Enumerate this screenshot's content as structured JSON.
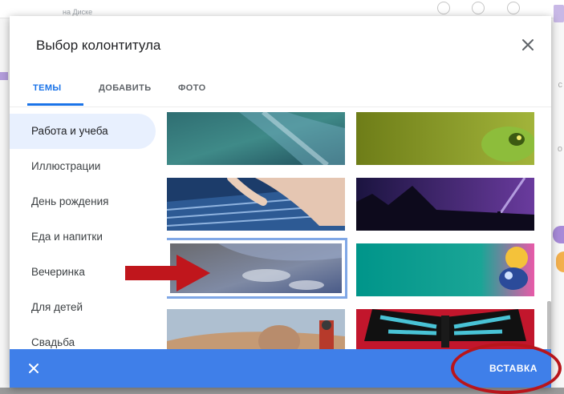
{
  "background": {
    "breadcrumb": "на Диске"
  },
  "dialog": {
    "title": "Выбор колонтитула",
    "tabs": [
      {
        "label": "ТЕМЫ",
        "active": true
      },
      {
        "label": "ДОБАВИТЬ",
        "active": false
      },
      {
        "label": "ФОТО",
        "active": false
      }
    ],
    "categories": [
      {
        "label": "Работа и учеба",
        "active": true
      },
      {
        "label": "Иллюстрации",
        "active": false
      },
      {
        "label": "День рождения",
        "active": false
      },
      {
        "label": "Еда и напитки",
        "active": false
      },
      {
        "label": "Вечеринка",
        "active": false
      },
      {
        "label": "Для детей",
        "active": false
      },
      {
        "label": "Свадьба",
        "active": false
      }
    ],
    "thumbnails": [
      {
        "subject": "ocean-waves",
        "selected": false
      },
      {
        "subject": "frog-green",
        "selected": false
      },
      {
        "subject": "typing-keyboard",
        "selected": false
      },
      {
        "subject": "night-sky-flashlight",
        "selected": false
      },
      {
        "subject": "earth-from-orbit",
        "selected": true
      },
      {
        "subject": "teal-bug-robot",
        "selected": false
      },
      {
        "subject": "person-desert",
        "selected": false
      },
      {
        "subject": "blue-butterfly",
        "selected": false
      }
    ],
    "footer": {
      "insert_label": "ВСТАВКА"
    }
  },
  "annotations": {
    "arrow_color": "#c0161c",
    "ellipse_color": "#b8151b"
  },
  "colors": {
    "accent": "#1a73e8",
    "footer_bg": "#3f7fe9",
    "selected_category_bg": "#e8f0fe"
  }
}
